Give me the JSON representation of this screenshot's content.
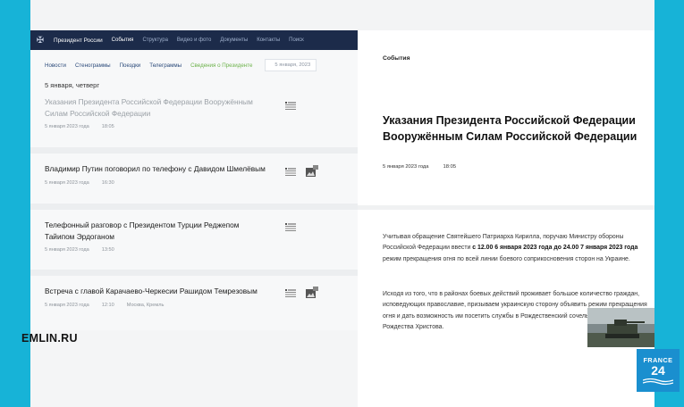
{
  "nav": {
    "site_name": "Президент России",
    "items": [
      "События",
      "Структура",
      "Видео и фото",
      "Документы",
      "Контакты",
      "Поиск"
    ]
  },
  "subnav": {
    "items": [
      "Новости",
      "Стенограммы",
      "Поездки",
      "Телеграммы",
      "Сведения о Президенте"
    ],
    "date_value": "5 января, 2023"
  },
  "feed": {
    "day_heading": "5 января, четверг",
    "items": [
      {
        "title": "Указания Президента Российской Федерации Вооружённым Силам Российской Федерации",
        "date": "5 января 2023 года",
        "time": "18:05",
        "location": "",
        "has_photo": false,
        "dimmed": true
      },
      {
        "title": "Владимир Путин поговорил по телефону с Давидом Шмелёвым",
        "date": "5 января 2023 года",
        "time": "16:30",
        "location": "",
        "has_photo": true,
        "dimmed": false
      },
      {
        "title": "Телефонный разговор с Президентом Турции Реджепом Тайипом Эрдоганом",
        "date": "5 января 2023 года",
        "time": "13:50",
        "location": "",
        "has_photo": false,
        "dimmed": false
      },
      {
        "title": "Встреча с главой Карачаево-Черкесии Рашидом Темрезовым",
        "date": "5 января 2023 года",
        "time": "12:10",
        "location": "Москва, Кремль",
        "has_photo": true,
        "dimmed": false
      }
    ]
  },
  "article": {
    "section": "События",
    "title": "Указания Президента Российской Федерации Вооружённым Силам Российской Федерации",
    "date": "5 января 2023 года",
    "time": "18:05",
    "para1_a": "Учитывая обращение Святейшего Патриарха Кирилла, поручаю Министру обороны Российской Федерации ввести ",
    "para1_b": "с 12.00 6 января 2023 года до 24.00 7 января 2023 года",
    "para1_c": " режим прекращения огня по всей линии боевого соприкосновения сторон на Украине.",
    "para2": "Исходя из того, что в районах боевых действий проживает большое количество граждан, исповедующих православие, призываем украинскую сторону объявить режим прекращения огня и дать возможность им посетить службы в Рождественский сочельник, а также в День Рождества Христова."
  },
  "overlay": {
    "watermark": "EMLIN.RU",
    "logo_top": "FRANCE",
    "logo_num": "24"
  },
  "colors": {
    "frame": "#17b3d7",
    "navbar": "#1c2b4a",
    "active_sub": "#6cb24a",
    "logo": "#1a8fcf"
  }
}
